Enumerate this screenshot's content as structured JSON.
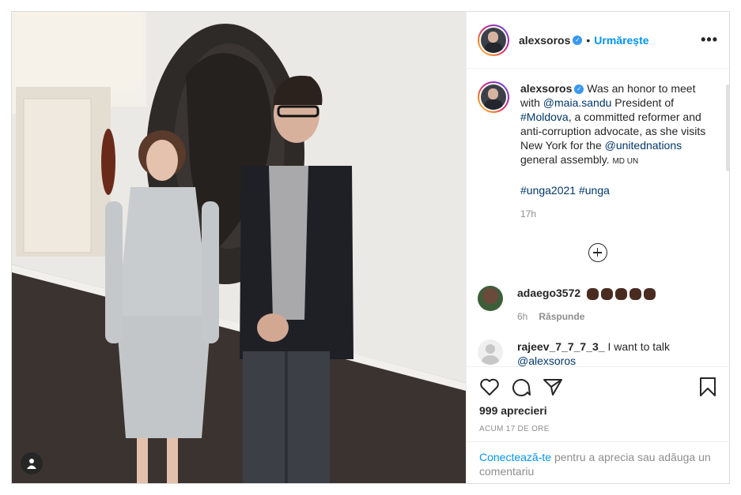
{
  "post": {
    "username": "alexsoros",
    "follow_label": "Urmărește",
    "separator": "•",
    "more_glyph": "•••"
  },
  "caption": {
    "username": "alexsoros",
    "text_1": "Was an honor to meet with ",
    "mention_1": "@maia.sandu",
    "text_2": " President of ",
    "hashtag_1": "#Moldova",
    "text_3": ", a committed reformer and anti-corruption advocate, as she visits New York for the ",
    "mention_2": "@unitednations",
    "text_4": " general assembly. ",
    "flags": "MD UN",
    "hashtag_2": "#unga2021",
    "hashtag_3": "#unga",
    "time": "17h"
  },
  "comments": [
    {
      "username": "adaego3572",
      "reaction": "fist-emoji x5",
      "time": "6h",
      "reply_label": "Răspunde"
    },
    {
      "username": "rajeev_7_7_7_3_",
      "text": " I want to talk",
      "mention": "@alexsoros"
    }
  ],
  "footer": {
    "likes": "999 aprecieri",
    "ago": "ACUM 17 DE ORE",
    "login_cta": "Conectează-te",
    "login_rest": " pentru a aprecia sau adăuga un comentariu"
  },
  "colors": {
    "link": "#00376b",
    "accent": "#0095f6",
    "verified": "#3897f0"
  },
  "icons": [
    "person-tag-icon",
    "verified-icon",
    "more-options-icon",
    "load-more-icon",
    "heart-icon",
    "comment-icon",
    "share-icon",
    "bookmark-icon"
  ]
}
